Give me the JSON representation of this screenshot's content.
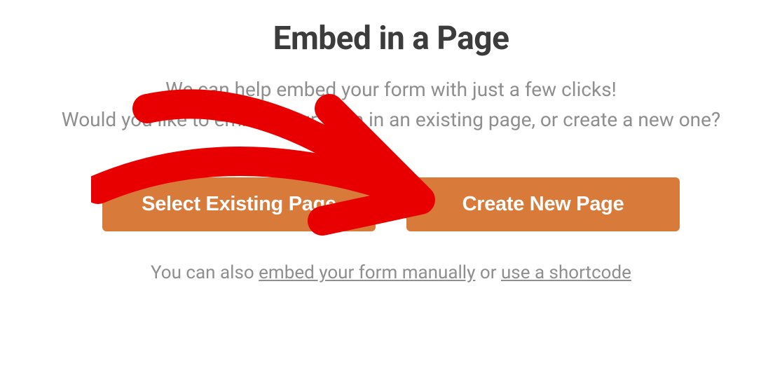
{
  "title": "Embed in a Page",
  "subtitle_line1": "We can help embed your form with just a few clicks!",
  "subtitle_line2": "Would you like to embed your form in an existing page, or create a new one?",
  "buttons": {
    "select_existing": "Select Existing Page",
    "create_new": "Create New Page"
  },
  "footer": {
    "prefix": "You can also ",
    "link1": "embed your form manually",
    "middle": " or ",
    "link2": "use a shortcode"
  }
}
